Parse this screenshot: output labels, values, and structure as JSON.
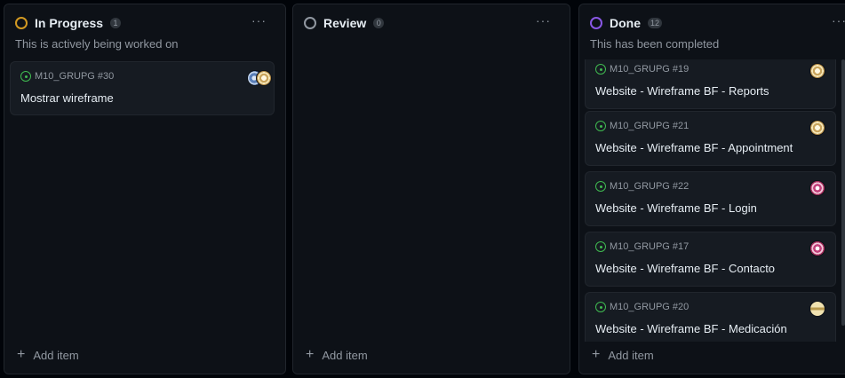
{
  "columns": [
    {
      "title": "In Progress",
      "count": "1",
      "status_color": "#d29922",
      "description": "This is actively being worked on",
      "menu": "···",
      "add_item": "Add item",
      "cards": [
        {
          "repo": "M10_GRUPG #30",
          "title": "Mostrar wireframe",
          "avatars": [
            "blue",
            "gold"
          ]
        }
      ]
    },
    {
      "title": "Review",
      "count": "0",
      "status_color": "#9198a1",
      "description": "",
      "menu": "···",
      "add_item": "Add item",
      "cards": []
    },
    {
      "title": "Done",
      "count": "12",
      "status_color": "#8957e5",
      "description": "This has been completed",
      "menu": "···",
      "add_item": "Add item",
      "cards": [
        {
          "repo": "M10_GRUPG #19",
          "title": "Website - Wireframe BF - Reports",
          "avatars": [
            "gold"
          ]
        },
        {
          "repo": "M10_GRUPG #21",
          "title": "Website - Wireframe BF - Appointment",
          "avatars": [
            "gold"
          ]
        },
        {
          "repo": "M10_GRUPG #22",
          "title": "Website - Wireframe BF - Login",
          "avatars": [
            "pink"
          ]
        },
        {
          "repo": "M10_GRUPG #17",
          "title": "Website - Wireframe BF - Contacto",
          "avatars": [
            "pink"
          ]
        },
        {
          "repo": "M10_GRUPG #20",
          "title": "Website - Wireframe BF - Medicación",
          "avatars": [
            "cream"
          ]
        }
      ]
    }
  ],
  "icons": {
    "status": "circle-status-icon",
    "issue": "issue-open-icon",
    "add": "plus-icon",
    "menu": "kebab-menu-icon"
  },
  "colors": {
    "background": "#010409",
    "column": "#0d1117",
    "card": "#161b22",
    "issue_open": "#3fb950"
  }
}
